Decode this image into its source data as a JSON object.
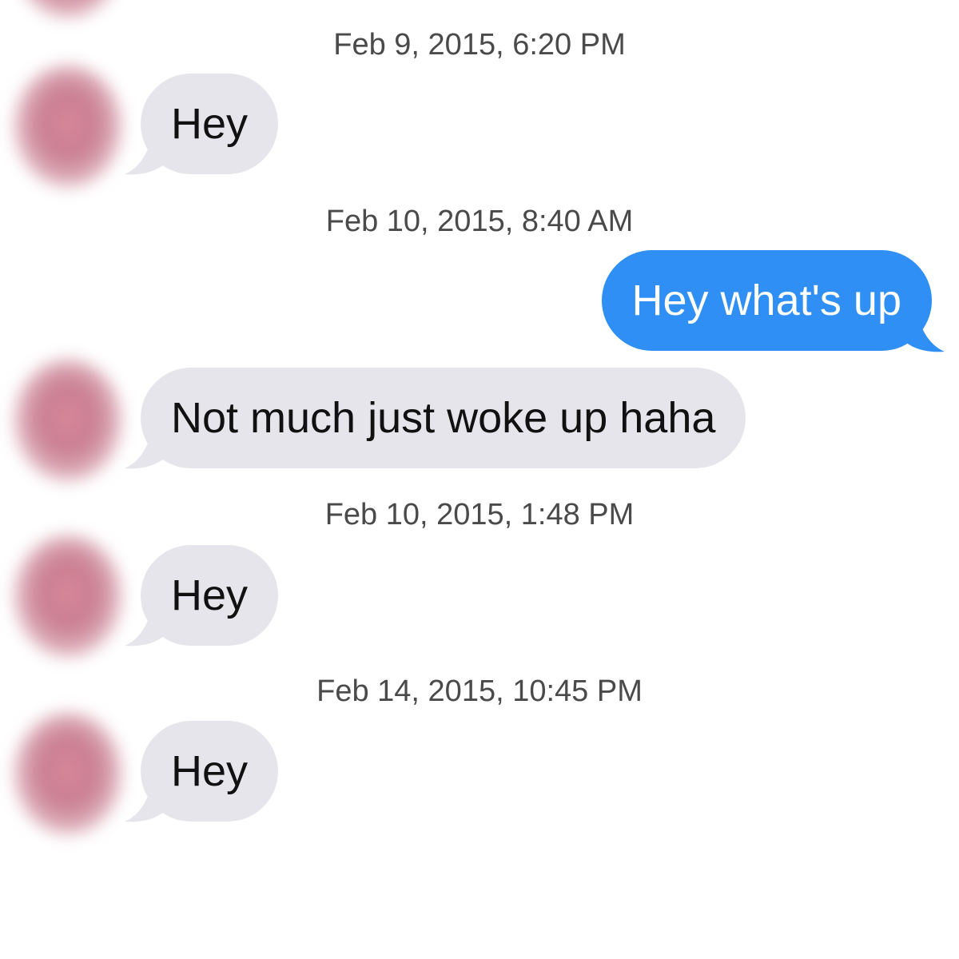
{
  "colors": {
    "incoming_bubble": "#e6e5eb",
    "outgoing_bubble": "#2f8ff5",
    "timestamp_text": "#4a4a4a",
    "background": "#ffffff"
  },
  "conversation": {
    "timestamps": [
      "Feb 9, 2015, 6:20 PM",
      "Feb 10, 2015, 8:40 AM",
      "Feb 10, 2015, 1:48 PM",
      "Feb 14, 2015, 10:45 PM"
    ],
    "messages": [
      {
        "sender": "them",
        "text": "Hey"
      },
      {
        "sender": "me",
        "text": "Hey what's up"
      },
      {
        "sender": "them",
        "text": "Not much just woke up haha"
      },
      {
        "sender": "them",
        "text": "Hey"
      },
      {
        "sender": "them",
        "text": "Hey"
      }
    ]
  }
}
